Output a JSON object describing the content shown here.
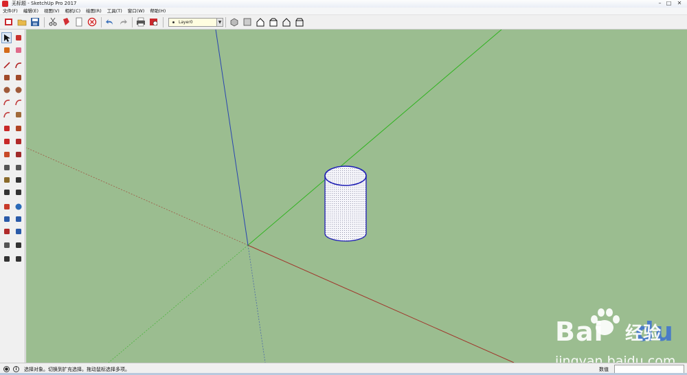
{
  "window": {
    "title": "无标题 - SketchUp Pro 2017",
    "controls": {
      "minimize": "–",
      "maximize": "□",
      "close": "✕"
    }
  },
  "menu": {
    "items": [
      "文件(F)",
      "编辑(E)",
      "视图(V)",
      "相机(C)",
      "绘图(R)",
      "工具(T)",
      "窗口(W)",
      "帮助(H)"
    ]
  },
  "toolbar": {
    "layer": {
      "value": "Layer0"
    },
    "buttons": [
      "getting-started",
      "open",
      "save",
      "cut",
      "paint",
      "erase",
      "delete",
      "undo",
      "redo",
      "print",
      "model-info"
    ],
    "view_buttons": [
      "iso",
      "top",
      "front",
      "right",
      "back",
      "left"
    ]
  },
  "palette": {
    "tools": [
      [
        "select",
        "component"
      ],
      [
        "paint-bucket",
        "eraser"
      ],
      [
        "line",
        "freehand"
      ],
      [
        "rectangle",
        "rotated-rectangle"
      ],
      [
        "circle",
        "polygon"
      ],
      [
        "arc",
        "two-point-arc"
      ],
      [
        "three-point-arc",
        "pie"
      ],
      [
        "move",
        "push-pull"
      ],
      [
        "rotate",
        "follow-me"
      ],
      [
        "scale",
        "offset"
      ],
      [
        "tape-measure",
        "dimension"
      ],
      [
        "protractor",
        "text"
      ],
      [
        "axes",
        "3d-text"
      ],
      [
        "section-plane",
        "orbit"
      ],
      [
        "zoom",
        "zoom-window"
      ],
      [
        "zoom-extents",
        "previous"
      ],
      [
        "position-camera",
        "look-around"
      ],
      [
        "walk",
        "pan"
      ]
    ],
    "selected": "select"
  },
  "status": {
    "text": "选择对象。切换到扩充选择。拖动鼠标选择多项。",
    "measurements_label": "数值",
    "measurements_value": ""
  },
  "watermark": {
    "brand": "Bai",
    "brand2": "du",
    "cn": "经验",
    "url": "jingyan.baidu.com"
  },
  "colors": {
    "viewport_bg": "#9bbd90",
    "axis_red": "#a0342a",
    "axis_green": "#2fb31f",
    "axis_blue": "#2844b0",
    "edge": "#1f1fb4"
  }
}
